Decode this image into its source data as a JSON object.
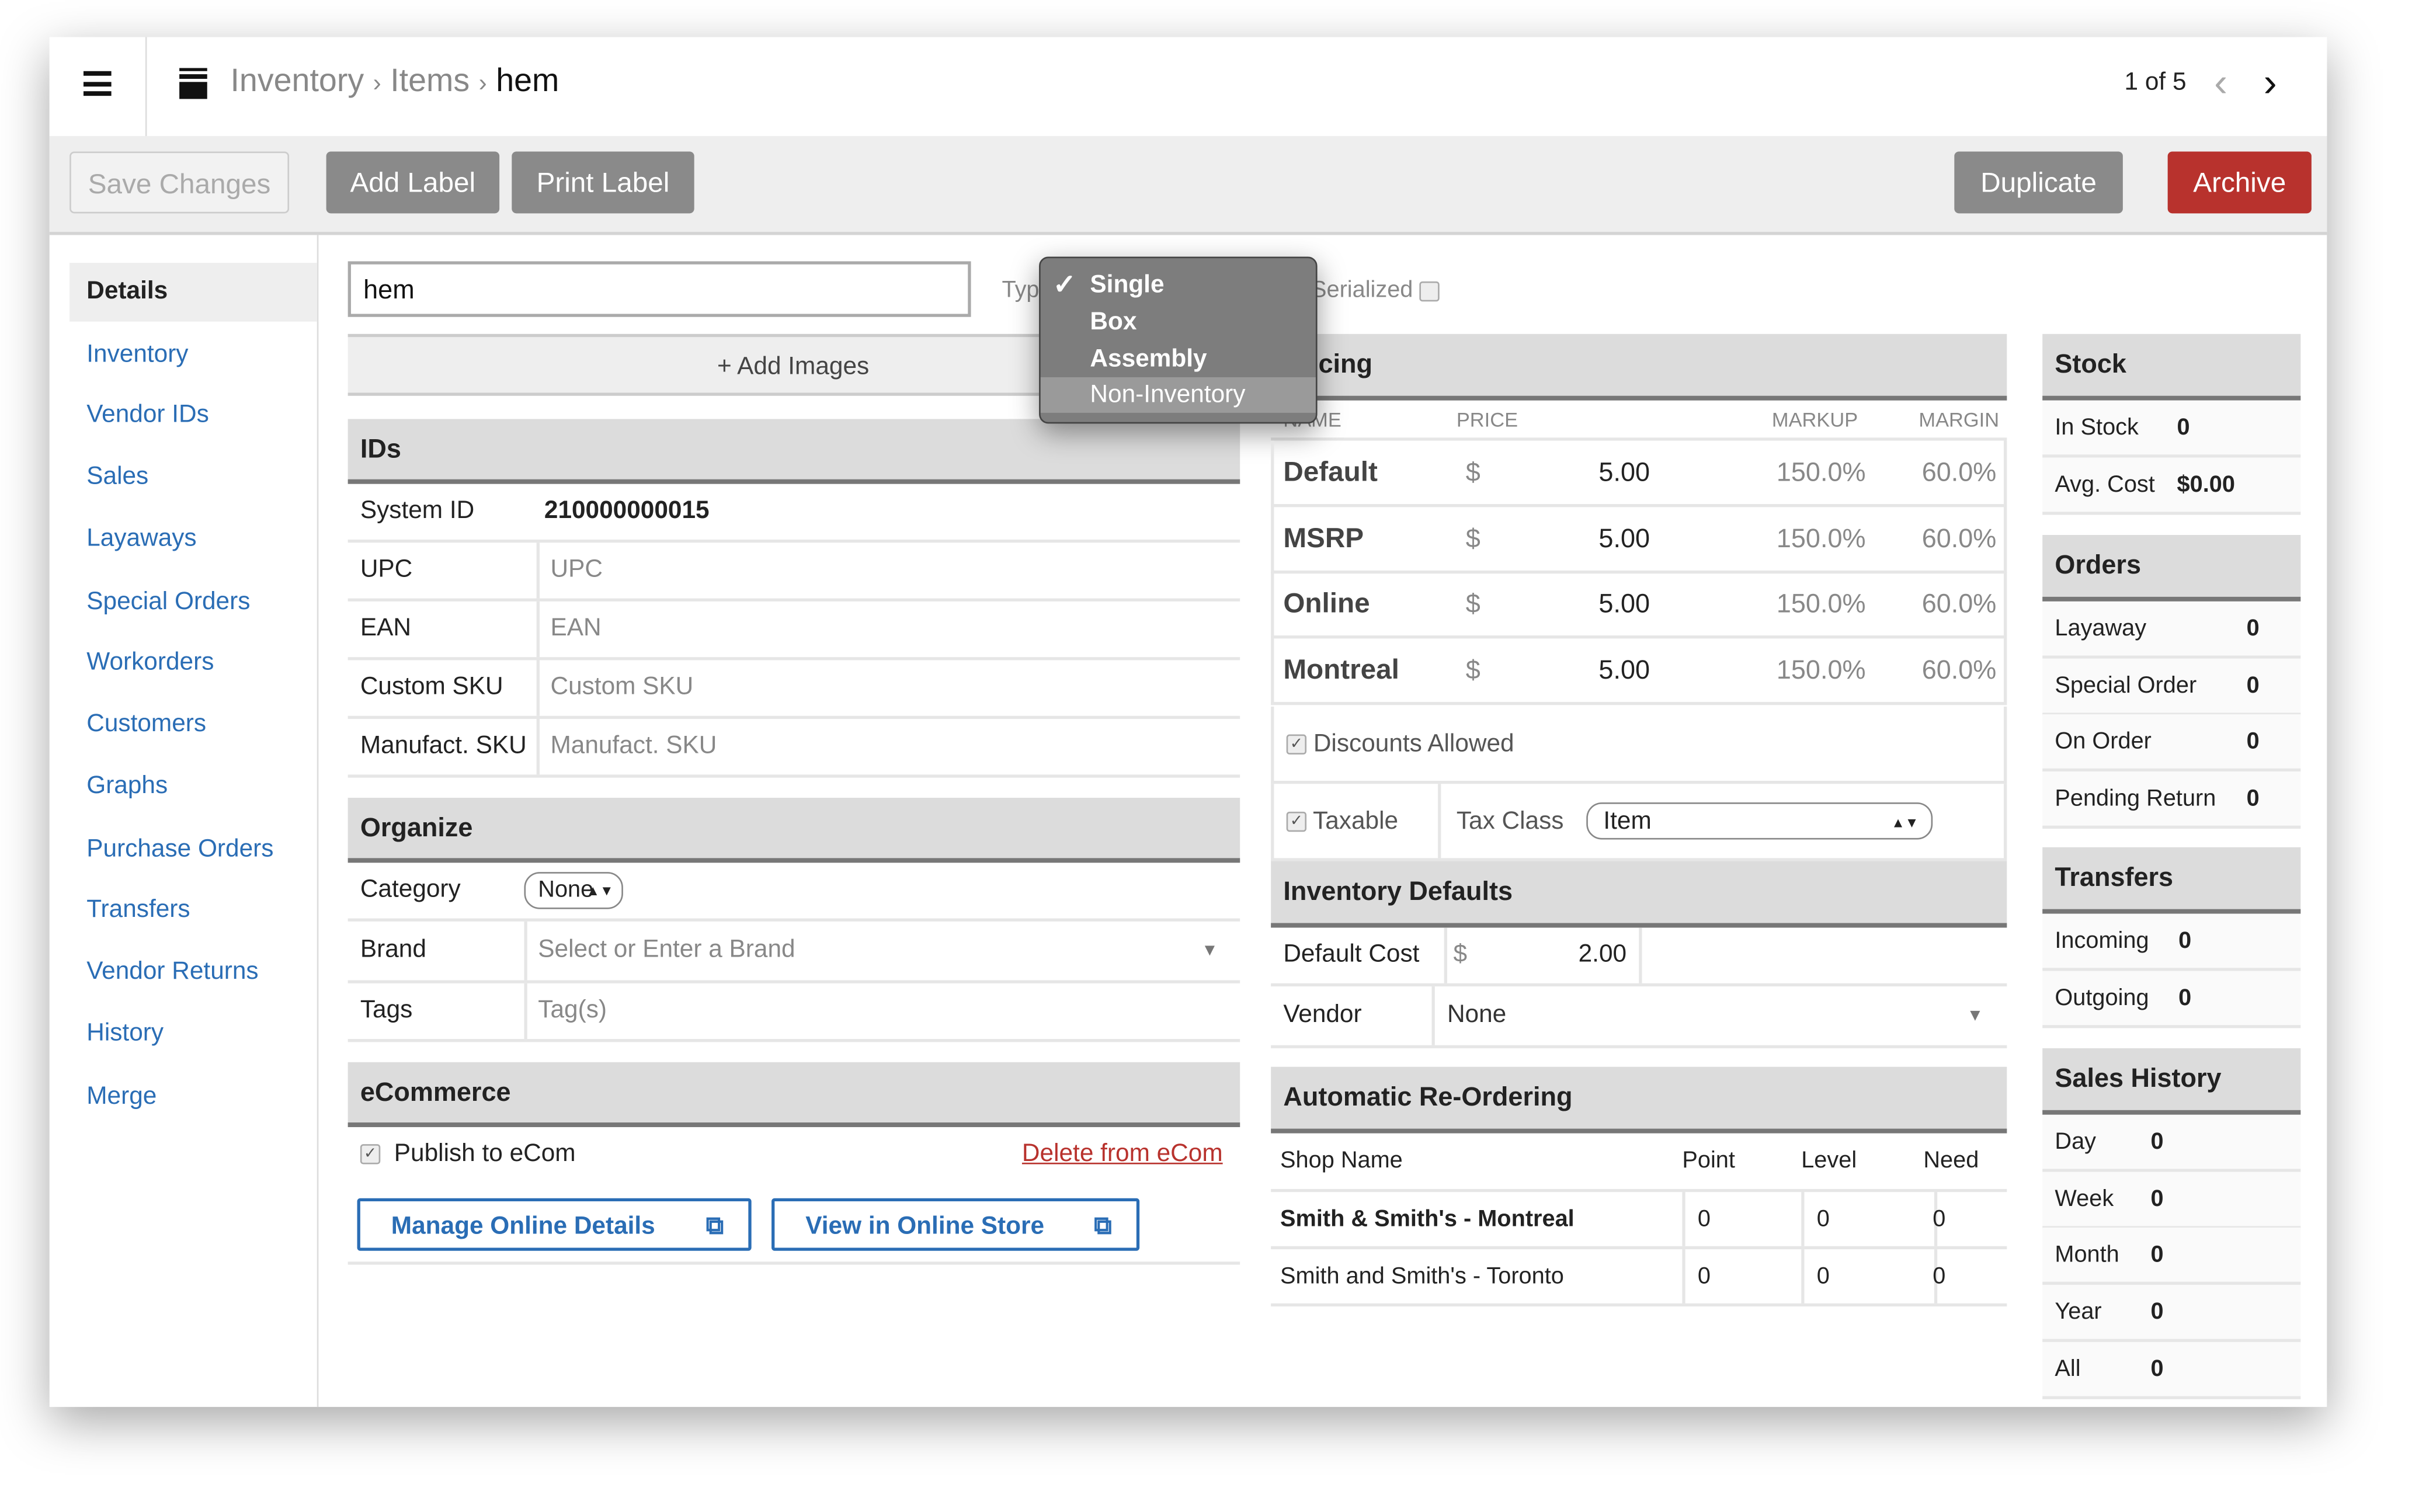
{
  "header": {
    "breadcrumb": [
      "Inventory",
      "Items",
      "hem"
    ],
    "pager": "1 of 5"
  },
  "toolbar": {
    "save": "Save Changes",
    "add_label": "Add Label",
    "print_label": "Print Label",
    "duplicate": "Duplicate",
    "archive": "Archive"
  },
  "colors": {
    "archive": "#b8322d",
    "link": "#2a6db5",
    "button": "#8a8a8a"
  },
  "sidebar": {
    "items": [
      "Details",
      "Inventory",
      "Vendor IDs",
      "Sales",
      "Layaways",
      "Special Orders",
      "Workorders",
      "Customers",
      "Graphs",
      "Purchase Orders",
      "Transfers",
      "Vendor Returns",
      "History",
      "Merge"
    ],
    "active": "Details"
  },
  "item": {
    "name": "hem",
    "type_label": "Typ",
    "serialized_label": "Serialized",
    "add_images": "+ Add Images"
  },
  "type_dropdown": {
    "options": [
      "Single",
      "Box",
      "Assembly",
      "Non-Inventory"
    ],
    "selected": "Single",
    "highlighted": "Non-Inventory"
  },
  "ids": {
    "title": "IDs",
    "rows": [
      {
        "label": "System ID",
        "value": "210000000015"
      },
      {
        "label": "UPC",
        "placeholder": "UPC"
      },
      {
        "label": "EAN",
        "placeholder": "EAN"
      },
      {
        "label": "Custom SKU",
        "placeholder": "Custom SKU"
      },
      {
        "label": "Manufact. SKU",
        "placeholder": "Manufact. SKU"
      }
    ]
  },
  "organize": {
    "title": "Organize",
    "category_label": "Category",
    "category_value": "None",
    "brand_label": "Brand",
    "brand_placeholder": "Select or Enter a Brand",
    "tags_label": "Tags",
    "tags_placeholder": "Tag(s)"
  },
  "ecommerce": {
    "title": "eCommerce",
    "publish": "Publish to eCom",
    "delete": "Delete from eCom",
    "manage": "Manage Online Details",
    "view": "View in Online Store"
  },
  "pricing": {
    "title": "icing",
    "headers": [
      "NAME",
      "PRICE",
      "MARKUP",
      "MARGIN"
    ],
    "rows": [
      {
        "name": "Default",
        "cur": "$",
        "price": "5.00",
        "markup": "150.0%",
        "margin": "60.0%"
      },
      {
        "name": "MSRP",
        "cur": "$",
        "price": "5.00",
        "markup": "150.0%",
        "margin": "60.0%"
      },
      {
        "name": "Online",
        "cur": "$",
        "price": "5.00",
        "markup": "150.0%",
        "margin": "60.0%"
      },
      {
        "name": "Montreal",
        "cur": "$",
        "price": "5.00",
        "markup": "150.0%",
        "margin": "60.0%"
      }
    ],
    "discounts": "Discounts Allowed",
    "taxable": "Taxable",
    "tax_class_label": "Tax Class",
    "tax_class": "Item"
  },
  "inv_defaults": {
    "title": "Inventory Defaults",
    "cost_label": "Default Cost",
    "cur": "$",
    "cost": "2.00",
    "vendor_label": "Vendor",
    "vendor": "None"
  },
  "reorder": {
    "title": "Automatic Re-Ordering",
    "headers": [
      "Shop Name",
      "Point",
      "Level",
      "Need"
    ],
    "rows": [
      {
        "shop": "Smith & Smith's - Montreal",
        "point": "0",
        "level": "0",
        "need": "0"
      },
      {
        "shop": "Smith and Smith's - Toronto",
        "point": "0",
        "level": "0",
        "need": "0"
      }
    ]
  },
  "stock": {
    "title": "Stock",
    "rows": [
      {
        "label": "In Stock",
        "value": "0"
      },
      {
        "label": "Avg. Cost",
        "value": "$0.00"
      }
    ]
  },
  "orders": {
    "title": "Orders",
    "rows": [
      {
        "label": "Layaway",
        "value": "0"
      },
      {
        "label": "Special Order",
        "value": "0"
      },
      {
        "label": "On Order",
        "value": "0"
      },
      {
        "label": "Pending Return",
        "value": "0"
      }
    ]
  },
  "transfers": {
    "title": "Transfers",
    "rows": [
      {
        "label": "Incoming",
        "value": "0"
      },
      {
        "label": "Outgoing",
        "value": "0"
      }
    ]
  },
  "sales_history": {
    "title": "Sales History",
    "rows": [
      {
        "label": "Day",
        "value": "0"
      },
      {
        "label": "Week",
        "value": "0"
      },
      {
        "label": "Month",
        "value": "0"
      },
      {
        "label": "Year",
        "value": "0"
      },
      {
        "label": "All",
        "value": "0"
      }
    ]
  }
}
